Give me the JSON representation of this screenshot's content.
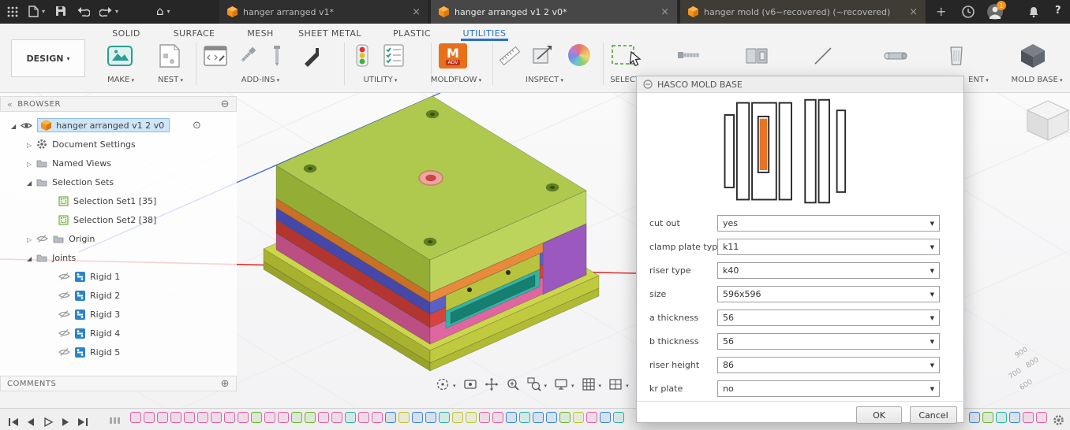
{
  "titlebar": {
    "tabs": [
      {
        "label": "hanger arranged v1*"
      },
      {
        "label": "hanger arranged v1 2 v0*"
      },
      {
        "label": "hanger mold (v6~recovered) (~recovered)"
      }
    ],
    "notification_count": "1"
  },
  "ribbon": {
    "workspace_label": "DESIGN",
    "tabs": [
      "SOLID",
      "SURFACE",
      "MESH",
      "SHEET METAL",
      "PLASTIC",
      "UTILITIES"
    ],
    "groups": {
      "make": "MAKE",
      "nest": "NEST",
      "addins": "ADD-INS",
      "utility": "UTILITY",
      "moldflow": "MOLDFLOW",
      "inspect": "INSPECT",
      "select": "SELECT",
      "ent": "ENT",
      "moldbase": "MOLD BASE"
    },
    "moldflow_letter": "M",
    "moldflow_badge": "ADV"
  },
  "browser": {
    "title": "BROWSER",
    "root_label": "hanger arranged v1 2 v0",
    "items": [
      {
        "label": "Document Settings"
      },
      {
        "label": "Named Views"
      },
      {
        "label": "Selection Sets"
      },
      {
        "label": "Selection Set1 [35]"
      },
      {
        "label": "Selection Set2 [38]"
      },
      {
        "label": "Origin"
      },
      {
        "label": "Joints"
      },
      {
        "label": "Rigid 1"
      },
      {
        "label": "Rigid 2"
      },
      {
        "label": "Rigid 3"
      },
      {
        "label": "Rigid 4"
      },
      {
        "label": "Rigid 5"
      }
    ],
    "comments_label": "COMMENTS"
  },
  "viewport": {
    "axis_labels": [
      "900",
      "800",
      "700",
      "600"
    ]
  },
  "dialog": {
    "title": "HASCO MOLD BASE",
    "fields": [
      {
        "label": "cut out",
        "value": "yes"
      },
      {
        "label": "clamp plate type",
        "value": "k11"
      },
      {
        "label": "riser type",
        "value": "k40"
      },
      {
        "label": "size",
        "value": "596x596"
      },
      {
        "label": "a thickness",
        "value": "56"
      },
      {
        "label": "b thickness",
        "value": "56"
      },
      {
        "label": "riser height",
        "value": "86"
      },
      {
        "label": "kr plate",
        "value": "no"
      }
    ],
    "ok_label": "OK",
    "cancel_label": "Cancel"
  },
  "timeline": {
    "palette": {
      "pink": "#e060a8",
      "green": "#6ab42e",
      "teal": "#2cb2a6",
      "blue": "#3a85d8",
      "yellow": "#bcc432"
    },
    "icons": [
      "pink",
      "pink",
      "pink",
      "pink",
      "pink",
      "pink",
      "pink",
      "pink",
      "pink",
      "green",
      "pink",
      "pink",
      "green",
      "green",
      "pink",
      "pink",
      "teal",
      "pink",
      "pink",
      "blue",
      "yellow",
      "blue",
      "blue",
      "teal",
      "yellow",
      "yellow",
      "pink",
      "pink",
      "blue",
      "teal",
      "blue",
      "blue",
      "green",
      "yellow",
      "pink",
      "blue",
      "teal"
    ],
    "icons_right": [
      "blue",
      "green",
      "teal",
      "blue",
      "pink",
      "pink"
    ]
  }
}
